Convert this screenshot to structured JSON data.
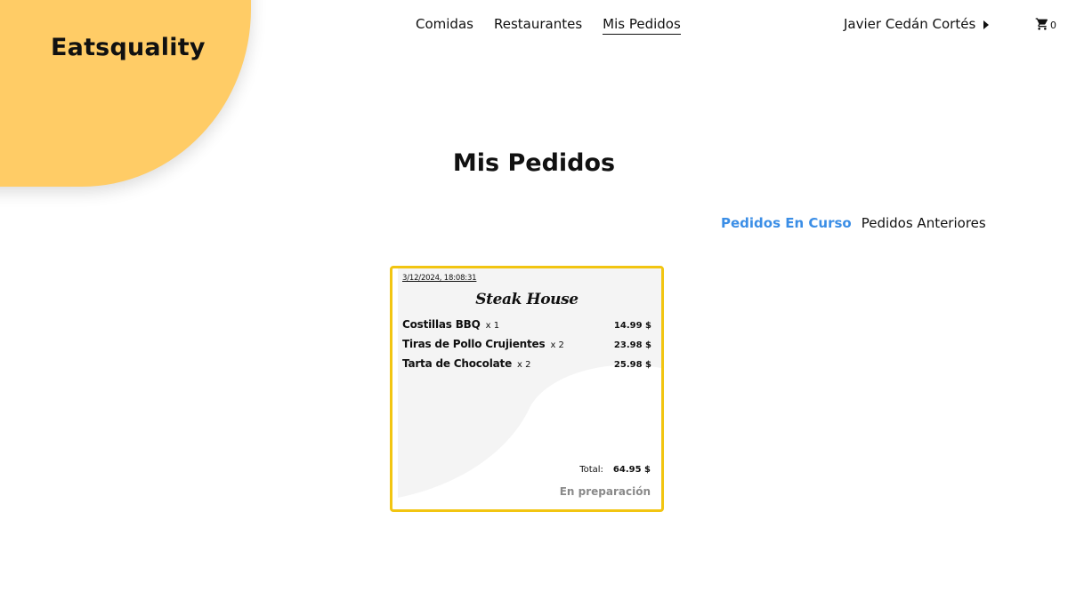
{
  "brand": {
    "name": "Eatsquality"
  },
  "nav": {
    "items": [
      {
        "label": "Comidas"
      },
      {
        "label": "Restaurantes"
      },
      {
        "label": "Mis Pedidos"
      }
    ]
  },
  "user": {
    "name": "Javier Cedán Cortés"
  },
  "cart": {
    "count": "0",
    "icon": "shopping-cart-icon"
  },
  "page": {
    "title": "Mis Pedidos"
  },
  "tabs": [
    {
      "label": "Pedidos En Curso"
    },
    {
      "label": "Pedidos Anteriores"
    }
  ],
  "order": {
    "date": "3/12/2024, 18:08:31",
    "restaurant": "Steak House",
    "items": [
      {
        "name": "Costillas BBQ",
        "qty": "x 1",
        "price": "14.99 $"
      },
      {
        "name": "Tiras de Pollo Crujientes",
        "qty": "x 2",
        "price": "23.98 $"
      },
      {
        "name": "Tarta de Chocolate",
        "qty": "x 2",
        "price": "25.98 $"
      }
    ],
    "total_label": "Total:",
    "total_value": "64.95 $",
    "status": "En preparación"
  },
  "colors": {
    "brand_yellow": "#ffcc66",
    "card_border": "#f2c511",
    "active_tab": "#3b8ee6",
    "status_text": "#8a8a8a"
  }
}
